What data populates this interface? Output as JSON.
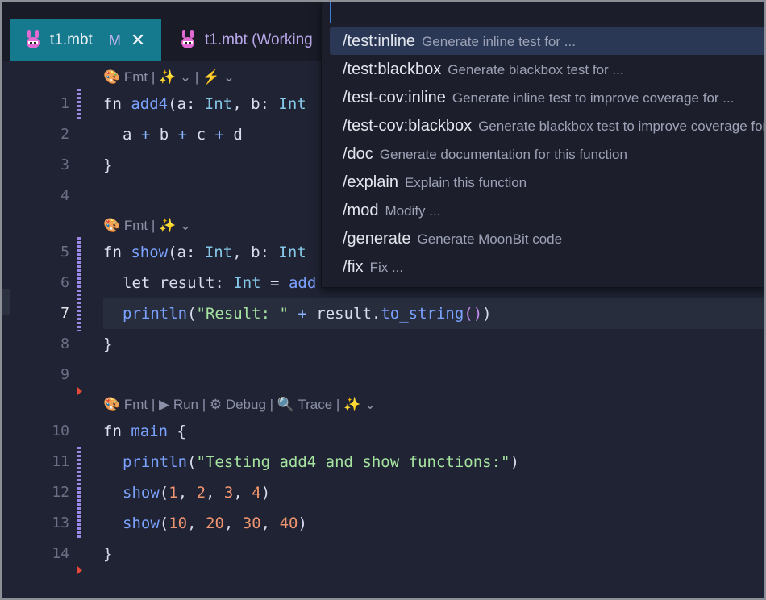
{
  "tabs": [
    {
      "label": "t1.mbt",
      "modified": "M",
      "close": "✕"
    },
    {
      "label": "t1.mbt (Working"
    }
  ],
  "lenses": {
    "l1": "🎨 Fmt | ✨ ⌄ | ⚡ ⌄",
    "l5": "🎨 Fmt | ✨ ⌄",
    "l10": "🎨 Fmt | ▶ Run | ⚙ Debug | 🔍 Trace | ✨ ⌄"
  },
  "code": {
    "line_numbers": [
      "1",
      "2",
      "3",
      "4",
      "5",
      "6",
      "7",
      "8",
      "9",
      "10",
      "11",
      "12",
      "13",
      "14"
    ],
    "l1": {
      "kw": "fn ",
      "name": "add4",
      "open": "(a: ",
      "t1": "Int",
      "mid": ", b: ",
      "t2": "Int"
    },
    "l2": {
      "a": "a ",
      "p1": "+",
      "b": " b ",
      "p2": "+",
      "c": " c ",
      "p3": "+",
      "d": " d"
    },
    "l3": "}",
    "l5": {
      "kw": "fn ",
      "name": "show",
      "open": "(a: ",
      "t1": "Int",
      "mid": ", b: ",
      "t2": "Int"
    },
    "l6": {
      "kw": "let ",
      "rest": "result: ",
      "ty": "Int",
      "eq": " = ",
      "fn": "add"
    },
    "l7": {
      "fn": "println",
      "open": "(",
      "str": "\"Result: \"",
      "plus": " + ",
      "rest": "result.",
      "m": "to_string",
      "pp": "()",
      "close": ")"
    },
    "l8": "}",
    "l10": {
      "kw": "fn ",
      "name": "main",
      "rest": " {"
    },
    "l11": {
      "fn": "println",
      "open": "(",
      "str": "\"Testing add4 and show functions:\"",
      "close": ")"
    },
    "l12": {
      "fn": "show",
      "open": "(",
      "n1": "1",
      "c1": ", ",
      "n2": "2",
      "c2": ", ",
      "n3": "3",
      "c3": ", ",
      "n4": "4",
      "close": ")"
    },
    "l13": {
      "fn": "show",
      "open": "(",
      "n1": "10",
      "c1": ", ",
      "n2": "20",
      "c2": ", ",
      "n3": "30",
      "c3": ", ",
      "n4": "40",
      "close": ")"
    },
    "l14": "}"
  },
  "commands": [
    {
      "cmd": "/test:inline",
      "desc": "Generate inline test for ..."
    },
    {
      "cmd": "/test:blackbox",
      "desc": "Generate blackbox test for ..."
    },
    {
      "cmd": "/test-cov:inline",
      "desc": "Generate inline test to improve coverage for ..."
    },
    {
      "cmd": "/test-cov:blackbox",
      "desc": "Generate blackbox test to improve coverage for ..."
    },
    {
      "cmd": "/doc",
      "desc": "Generate documentation for this function"
    },
    {
      "cmd": "/explain",
      "desc": "Explain this function"
    },
    {
      "cmd": "/mod",
      "desc": "Modify ..."
    },
    {
      "cmd": "/generate",
      "desc": "Generate MoonBit code"
    },
    {
      "cmd": "/fix",
      "desc": "Fix ..."
    }
  ],
  "colors": {
    "accent": "#157a8e",
    "selection": "#2b3855",
    "tab_inactive_text": "#b9a7ea"
  }
}
